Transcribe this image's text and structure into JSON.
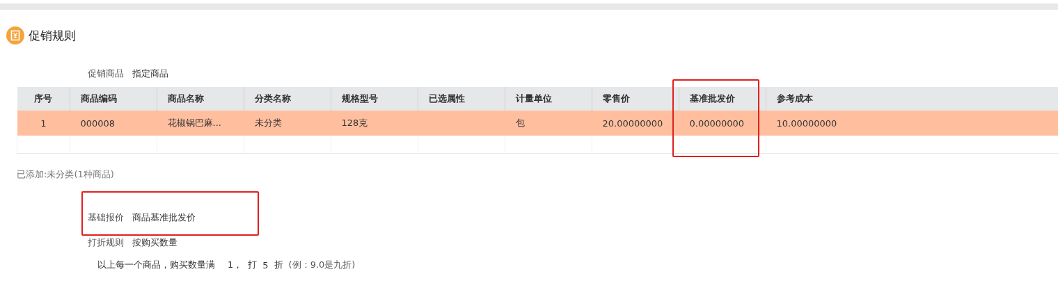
{
  "section": {
    "title": "促销规则"
  },
  "promo_goods": {
    "label": "促销商品",
    "value": "指定商品"
  },
  "table": {
    "columns": [
      {
        "label": "序号",
        "highlighted": false
      },
      {
        "label": "商品编码",
        "highlighted": false
      },
      {
        "label": "商品名称",
        "highlighted": false
      },
      {
        "label": "分类名称",
        "highlighted": false
      },
      {
        "label": "规格型号",
        "highlighted": false
      },
      {
        "label": "已选属性",
        "highlighted": false
      },
      {
        "label": "计量单位",
        "highlighted": false
      },
      {
        "label": "零售价",
        "highlighted": false
      },
      {
        "label": "基准批发价",
        "highlighted": true
      },
      {
        "label": "参考成本",
        "highlighted": false
      }
    ],
    "rows": [
      {
        "selected": true,
        "cells": [
          "1",
          "000008",
          "花椒锅巴麻...",
          "未分类",
          "128克",
          "",
          "包",
          "20.00000000",
          "0.00000000",
          "10.00000000"
        ]
      }
    ]
  },
  "added_note": "已添加:未分类(1种商品)",
  "fields": [
    {
      "label": "基础报价",
      "value": "商品基准批发价",
      "highlighted": true
    },
    {
      "label": "打折规则",
      "value": "按购买数量",
      "highlighted": false
    }
  ],
  "rule": {
    "text": "以上每一个商品，购买数量满",
    "quantity": "1，",
    "discount_prefix": "打",
    "discount": "5",
    "discount_suffix": "折",
    "example": "(例：9.0是九折)"
  }
}
